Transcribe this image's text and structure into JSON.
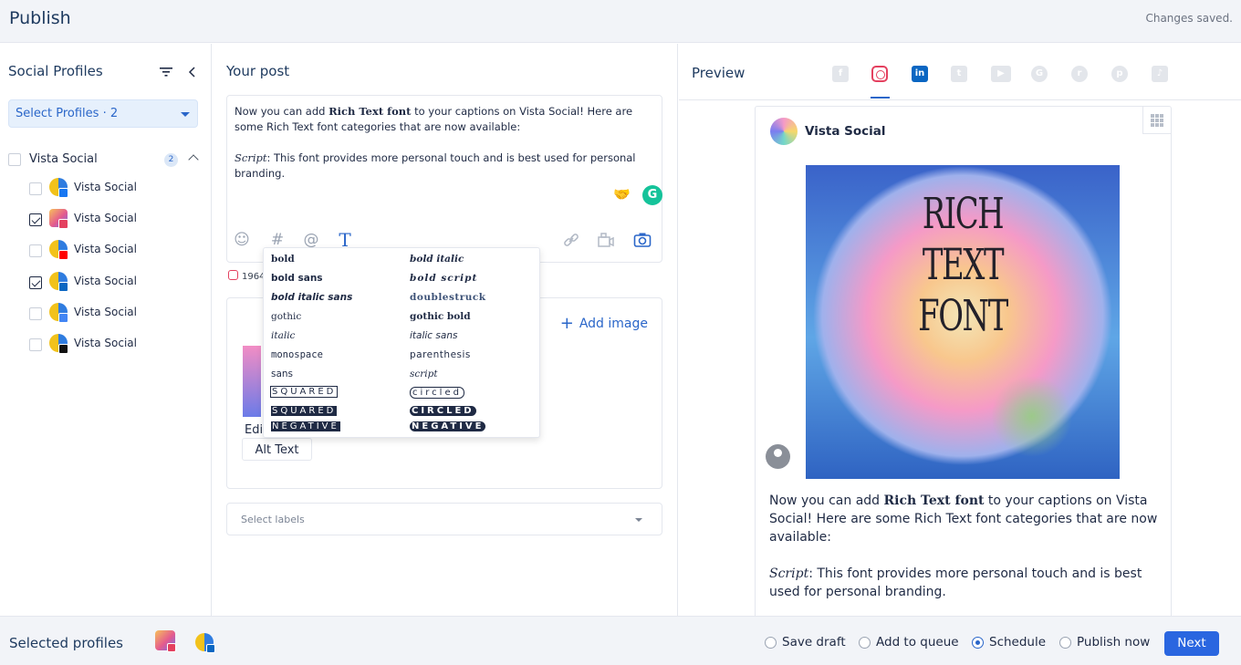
{
  "header": {
    "title": "Publish",
    "status": "Changes saved."
  },
  "sidebar": {
    "title": "Social Profiles",
    "select_button": "Select Profiles · 2",
    "group": {
      "name": "Vista Social",
      "count": "2"
    },
    "profiles": [
      {
        "name": "Vista Social",
        "network": "facebook",
        "checked": false,
        "badge_color": "#1877f2"
      },
      {
        "name": "Vista Social",
        "network": "instagram",
        "checked": true,
        "badge_color": "#e4405f"
      },
      {
        "name": "Vista Social",
        "network": "youtube",
        "checked": false,
        "badge_color": "#ff0000"
      },
      {
        "name": "Vista Social",
        "network": "linkedin",
        "checked": true,
        "badge_color": "#0a66c2"
      },
      {
        "name": "Vista Social",
        "network": "google",
        "checked": false,
        "badge_color": "#4285f4"
      },
      {
        "name": "Vista Social",
        "network": "tiktok",
        "checked": false,
        "badge_color": "#111111"
      }
    ]
  },
  "post": {
    "title": "Your post",
    "text_intro": "Now you can add ",
    "text_bold": "Rich Text font",
    "text_rest": " to your captions on Vista Social! Here are some Rich Text font categories that are now available:",
    "text_script": "Script",
    "text_script_rest": ": This font provides more personal touch and is best used for personal branding.",
    "char_count": "1964",
    "add_image": "Add image",
    "edit_label": "Edi",
    "alt_text": "Alt Text",
    "labels_placeholder": "Select labels",
    "toolbar_icons": [
      "emoji-icon",
      "hashtag-icon",
      "mention-icon",
      "text-format-icon",
      "link-icon",
      "media-library-icon",
      "camera-icon"
    ]
  },
  "font_menu": {
    "col1": [
      "bold",
      "bold sans",
      "bold italic sans",
      "gothic",
      "italic",
      "monospace",
      "sans",
      "SQUARED",
      "SQUARED",
      "NEGATIVE"
    ],
    "col2": [
      "bold italic",
      "bold script",
      "doublestruck",
      "gothic bold",
      "italic sans",
      "parenthesis",
      "script",
      "circled",
      "CIRCLED",
      "NEGATIVE"
    ]
  },
  "preview": {
    "title": "Preview",
    "networks": [
      "facebook",
      "instagram",
      "linkedin",
      "twitter",
      "youtube",
      "google",
      "reddit",
      "pinterest",
      "tiktok"
    ],
    "active_network": "instagram",
    "account_name": "Vista Social",
    "image_text": "RICH TEXT FONT",
    "caption_intro": "Now you can add ",
    "caption_bold": "Rich Text font",
    "caption_rest": " to your captions on Vista Social! Here are some Rich Text font categories that are now available:",
    "caption_script": "Script",
    "caption_script_rest": ": This font provides more personal touch and is best used for personal branding."
  },
  "footer": {
    "selected_label": "Selected profiles",
    "options": [
      "Save draft",
      "Add to queue",
      "Schedule",
      "Publish now"
    ],
    "selected_option": "Schedule",
    "next": "Next"
  },
  "colors": {
    "accent": "#2a66c9",
    "primary_button": "#2a66e0",
    "heading": "#1e3a5f"
  }
}
